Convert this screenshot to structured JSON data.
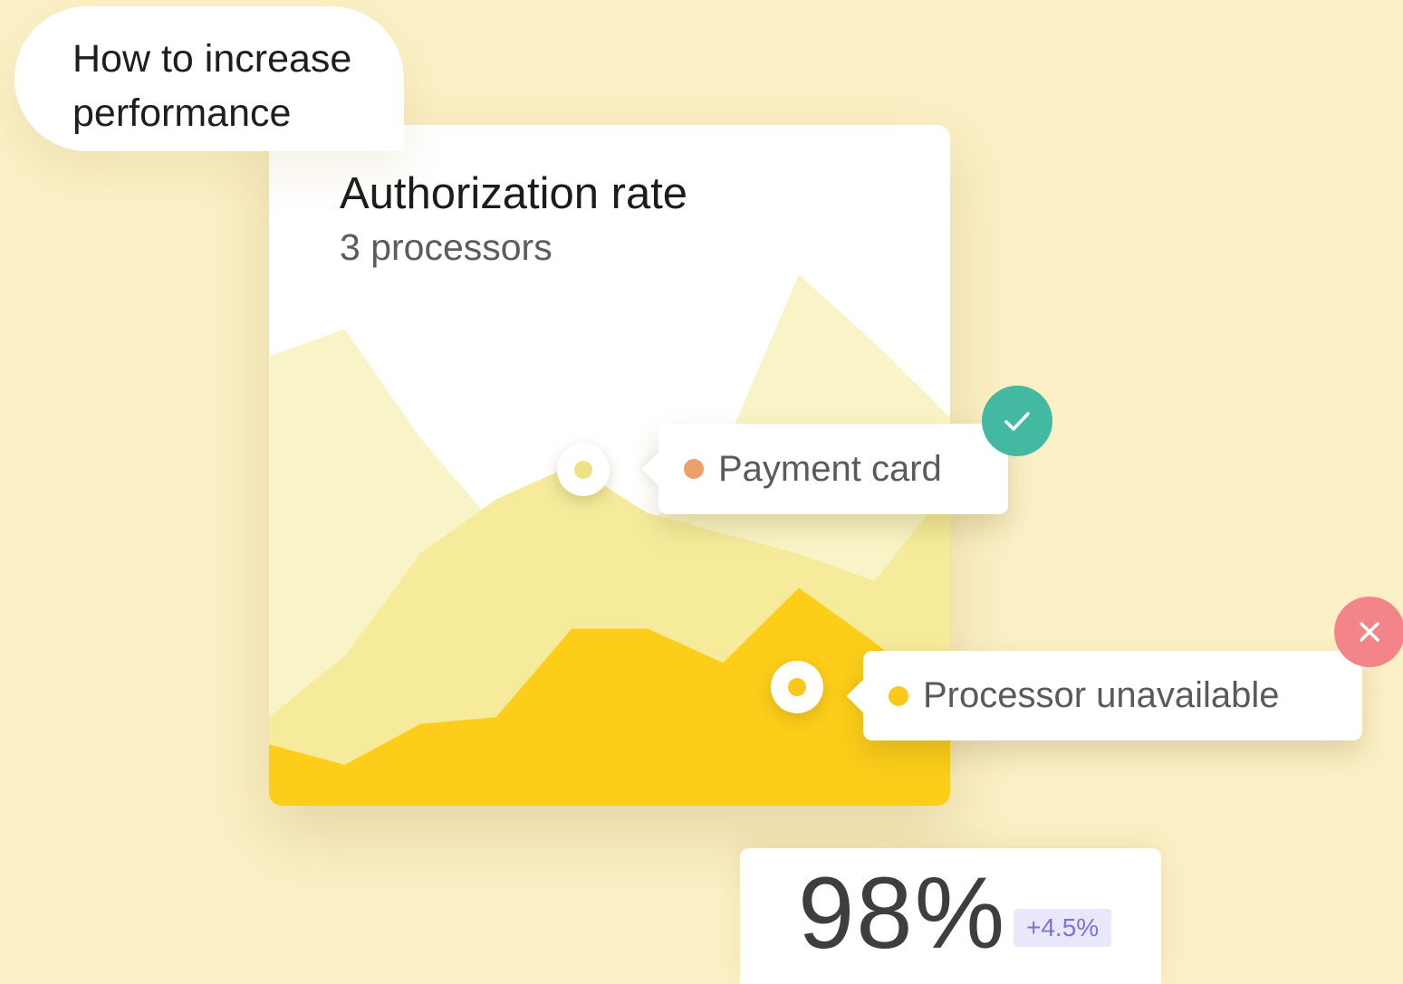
{
  "bubble": {
    "text": "How to increase\nperformance"
  },
  "card": {
    "title": "Authorization rate",
    "subtitle": "3 processors"
  },
  "chart_data": {
    "type": "area",
    "title": "Authorization rate",
    "subtitle": "3 processors",
    "x": [
      0,
      1,
      2,
      3,
      4,
      5,
      6,
      7,
      8,
      9
    ],
    "ylim": [
      0,
      100
    ],
    "grid": false,
    "series": [
      {
        "color": "#f9f4c7",
        "values": [
          66,
          70,
          54,
          41,
          40,
          41,
          52,
          78,
          68,
          57
        ]
      },
      {
        "color": "#f5eb9b",
        "values": [
          13,
          22,
          37,
          45,
          50,
          43,
          40,
          37,
          33,
          47
        ]
      },
      {
        "color": "#fccd19",
        "values": [
          9,
          6,
          12,
          13,
          26,
          26,
          21,
          32,
          24,
          15
        ]
      }
    ],
    "annotations": [
      {
        "label": "Payment card",
        "status": "success",
        "dot_color": "#ee9f6a"
      },
      {
        "label": "Processor unavailable",
        "status": "error",
        "dot_color": "#f9c81a"
      }
    ]
  },
  "metric": {
    "value": "98%",
    "delta": "+4.5%"
  },
  "colors": {
    "background": "#fbf0c6",
    "success": "#42b9a0",
    "error": "#f3858a",
    "delta_bg": "#e9e8fb",
    "delta_text": "#7a73d8"
  },
  "icons": {
    "success": "check-icon",
    "error": "close-icon"
  }
}
